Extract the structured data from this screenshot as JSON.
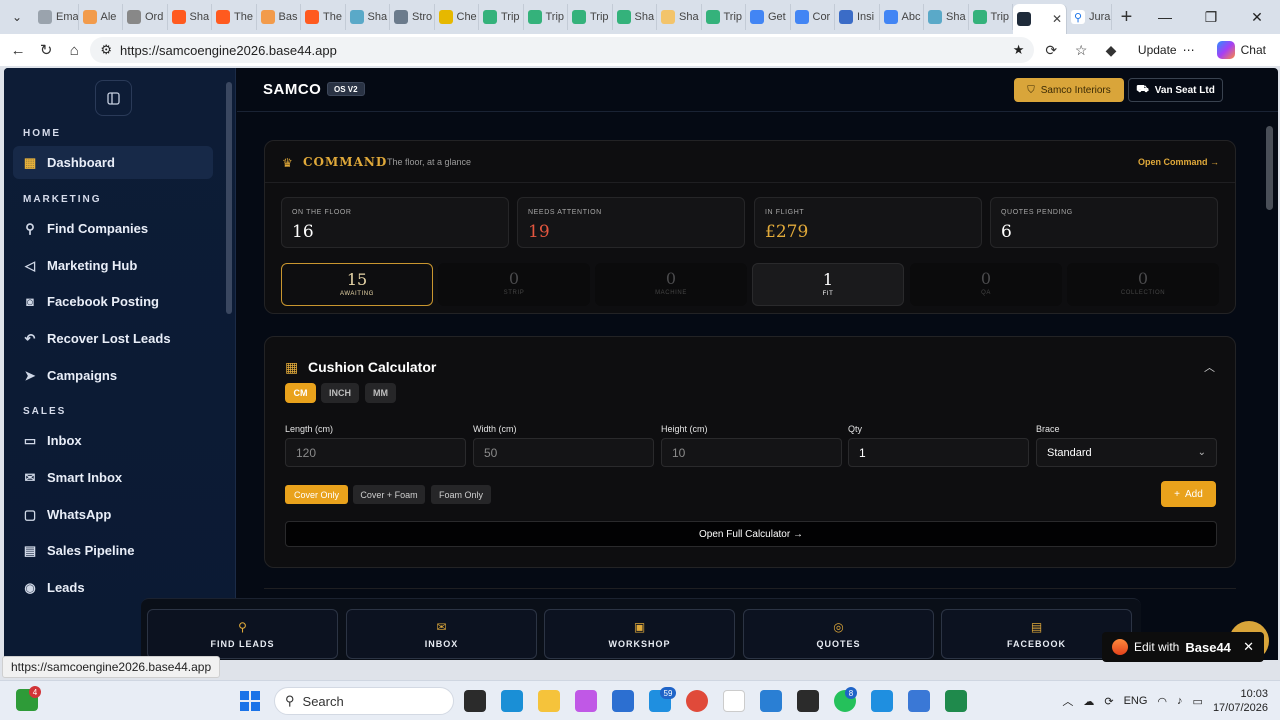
{
  "browser": {
    "tabs": [
      {
        "label": "Ema",
        "color": "#9aa3ad"
      },
      {
        "label": "Ale",
        "color": "#f29b4b"
      },
      {
        "label": "Ord",
        "color": "#888888"
      },
      {
        "label": "Sha",
        "color": "#ff5a1f"
      },
      {
        "label": "The",
        "color": "#ff5a1f"
      },
      {
        "label": "Bas",
        "color": "#f29b4b"
      },
      {
        "label": "The",
        "color": "#ff5a1f"
      },
      {
        "label": "Sha",
        "color": "#5aa9c8"
      },
      {
        "label": "Stro",
        "color": "#6b7b8c"
      },
      {
        "label": "Che",
        "color": "#e6b800"
      },
      {
        "label": "Trip",
        "color": "#34b27b"
      },
      {
        "label": "Trip",
        "color": "#34b27b"
      },
      {
        "label": "Trip",
        "color": "#34b27b"
      },
      {
        "label": "Sha",
        "color": "#34b27b"
      },
      {
        "label": "Sha",
        "color": "#f3c46b"
      },
      {
        "label": "Trip",
        "color": "#34b27b"
      },
      {
        "label": "Get",
        "color": "#4285f4"
      },
      {
        "label": "Cor",
        "color": "#4285f4"
      },
      {
        "label": "Insi",
        "color": "#3b6cc7"
      },
      {
        "label": "Abc",
        "color": "#4285f4"
      },
      {
        "label": "Sha",
        "color": "#5aa9c8"
      },
      {
        "label": "Trip",
        "color": "#34b27b"
      }
    ],
    "active_tab_label": "",
    "last_tab_label": "Jura",
    "url": "https://samcoengine2026.base44.app",
    "update_label": "Update",
    "chat_label": "Chat",
    "status_url": "https://samcoengine2026.base44.app"
  },
  "sidebar": {
    "sections": {
      "home": "HOME",
      "marketing": "MARKETING",
      "sales": "SALES"
    },
    "items": [
      {
        "label": "Dashboard",
        "icon": "grid-icon"
      },
      {
        "label": "Find Companies",
        "icon": "search-icon"
      },
      {
        "label": "Marketing Hub",
        "icon": "megaphone-icon"
      },
      {
        "label": "Facebook Posting",
        "icon": "camera-icon"
      },
      {
        "label": "Recover Lost Leads",
        "icon": "undo-icon"
      },
      {
        "label": "Campaigns",
        "icon": "send-icon"
      },
      {
        "label": "Inbox",
        "icon": "inbox-icon"
      },
      {
        "label": "Smart Inbox",
        "icon": "mail-icon"
      },
      {
        "label": "WhatsApp",
        "icon": "chat-icon"
      },
      {
        "label": "Sales Pipeline",
        "icon": "clipboard-icon"
      },
      {
        "label": "Leads",
        "icon": "user-circle-icon"
      }
    ]
  },
  "header": {
    "brand": "SAMCO",
    "badge": "OS V2",
    "samco_button": "Samco Interiors",
    "van_button": "Van Seat Ltd"
  },
  "command": {
    "title": "COMMAND",
    "subtitle": "The floor, at a glance",
    "link": "Open Command →",
    "stats": [
      {
        "label": "ON THE FLOOR",
        "value": "16",
        "color": "#ffffff"
      },
      {
        "label": "NEEDS ATTENTION",
        "value": "19",
        "color": "#e3563f"
      },
      {
        "label": "IN FLIGHT",
        "value": "£279",
        "color": "#e0a93a"
      },
      {
        "label": "QUOTES PENDING",
        "value": "6",
        "color": "#ffffff"
      }
    ],
    "stages": [
      {
        "value": "15",
        "label": "AWAITING",
        "state": "sel"
      },
      {
        "value": "0",
        "label": "STRIP",
        "state": "off"
      },
      {
        "value": "0",
        "label": "MACHINE",
        "state": "off"
      },
      {
        "value": "1",
        "label": "FIT",
        "state": "on"
      },
      {
        "value": "0",
        "label": "QA",
        "state": "off"
      },
      {
        "value": "0",
        "label": "COLLECTION",
        "state": "off"
      }
    ]
  },
  "calculator": {
    "title": "Cushion Calculator",
    "units": [
      "CM",
      "INCH",
      "MM"
    ],
    "fields": {
      "length_label": "Length (cm)",
      "length_placeholder": "120",
      "width_label": "Width (cm)",
      "width_placeholder": "50",
      "height_label": "Height (cm)",
      "height_placeholder": "10",
      "qty_label": "Qty",
      "qty_value": "1",
      "brace_label": "Brace",
      "brace_value": "Standard"
    },
    "modes": [
      "Cover Only",
      "Cover + Foam",
      "Foam Only"
    ],
    "add_label": "Add",
    "full_link": "Open Full Calculator →"
  },
  "quickbar": [
    {
      "label": "FIND LEADS",
      "icon": "search-icon"
    },
    {
      "label": "INBOX",
      "icon": "mail-icon"
    },
    {
      "label": "WORKSHOP",
      "icon": "briefcase-icon"
    },
    {
      "label": "QUOTES",
      "icon": "coins-icon"
    },
    {
      "label": "FACEBOOK",
      "icon": "film-icon"
    }
  ],
  "toast": {
    "prefix": "Edit with",
    "brand": "Base44"
  },
  "taskbar": {
    "search_label": "Search",
    "badge_left": "4",
    "badge_59": "59",
    "badge_8": "8",
    "lang": "ENG",
    "time": "10:03",
    "date": "17/07/2026"
  }
}
